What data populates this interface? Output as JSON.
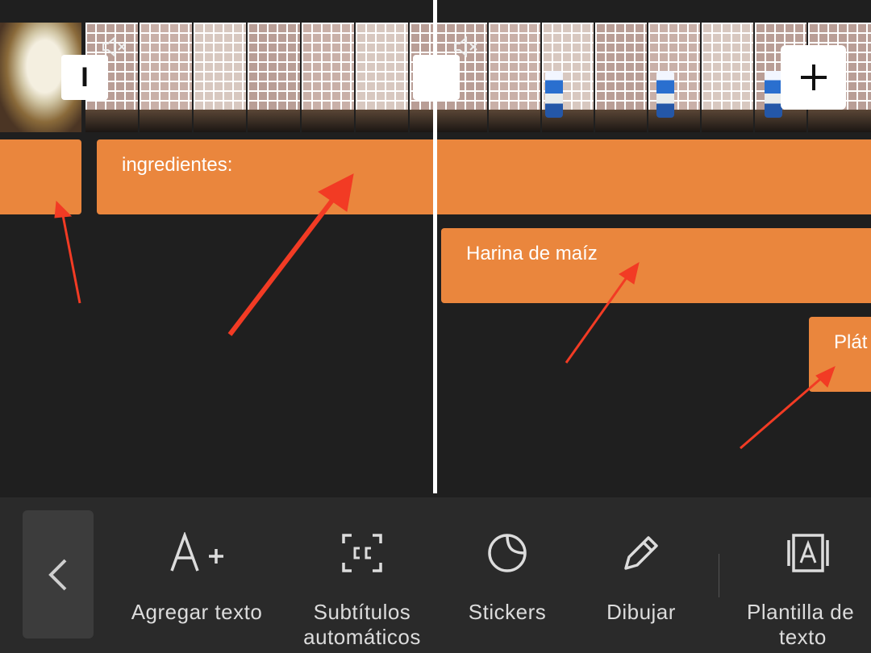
{
  "timeline": {
    "handle_left_label": "I",
    "text_clips": [
      {
        "label": ""
      },
      {
        "label": "ingredientes:"
      },
      {
        "label": ""
      },
      {
        "label": "Harina de maíz"
      },
      {
        "label": "Plát"
      }
    ]
  },
  "toolbar": {
    "back_label": "<",
    "tools": [
      {
        "label_1": "Agregar texto",
        "label_2": "",
        "icon": "text-add-icon"
      },
      {
        "label_1": "Subtítulos",
        "label_2": "automáticos",
        "icon": "closed-captions-icon"
      },
      {
        "label_1": "Stickers",
        "label_2": "",
        "icon": "sticker-icon"
      },
      {
        "label_1": "Dibujar",
        "label_2": "",
        "icon": "pencil-icon"
      },
      {
        "label_1": "Plantilla de",
        "label_2": "texto",
        "icon": "text-template-icon"
      }
    ]
  },
  "colors": {
    "background": "#1f1f1f",
    "toolbar": "#2a2a2a",
    "clip": "#ea863d",
    "arrow": "#f23b24"
  }
}
